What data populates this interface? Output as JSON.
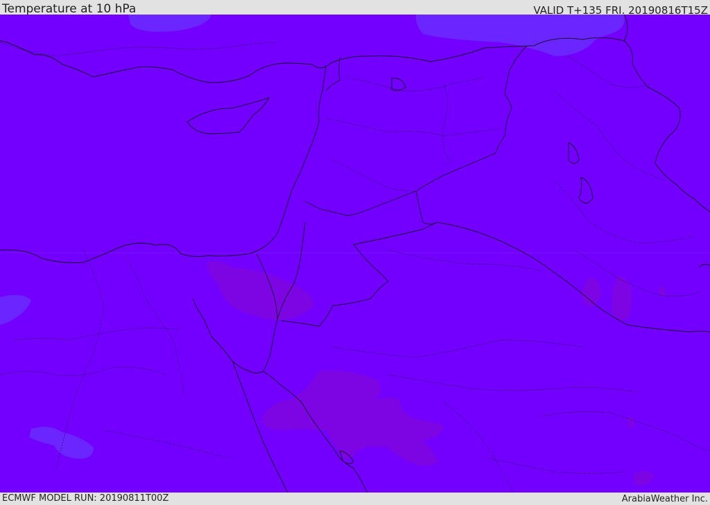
{
  "header": {
    "title": "Temperature at 10 hPa",
    "valid_time": "VALID T+135 FRI. 20190816T15Z"
  },
  "footer": {
    "model_run": "ECMWF MODEL RUN: 20190811T00Z",
    "credit": "ArabiaWeather Inc."
  },
  "map": {
    "colors": {
      "base_field": "#7300ff",
      "cooler_field": "#6a2dff",
      "warmer_field": "#7f05e0",
      "border_line": "#1a0a33"
    }
  }
}
